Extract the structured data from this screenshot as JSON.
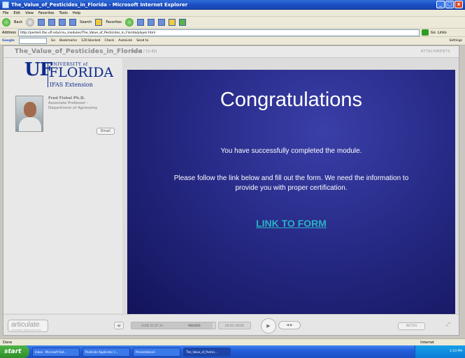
{
  "window": {
    "title": "The_Value_of_Pesticides_in_Florida - Microsoft Internet Explorer",
    "min": "_",
    "max": "□",
    "close": "x"
  },
  "menu": [
    "File",
    "Edit",
    "View",
    "Favorites",
    "Tools",
    "Help"
  ],
  "toolbar": {
    "back": "Back",
    "search": "Search",
    "favorites": "Favorites"
  },
  "address": {
    "label": "Address",
    "url": "http://pested.ifas.ufl.edu/cnu_modules/The_Value_of_Pesticides_in_Florida/player.html",
    "go": "Go",
    "links": "Links"
  },
  "google": {
    "logo": "Google",
    "go_to": "Go",
    "bookmarks": "Bookmarks",
    "blocked": "120 blocked",
    "check": "Check",
    "autolink": "AutoLink",
    "send": "Send to",
    "settings": "Settings"
  },
  "player": {
    "course_title": "The_Value_of_Pesticides_in_Florida",
    "time_info": "(11:40 / 11:42)",
    "attachments": "ATTACHMENTS"
  },
  "logo": {
    "mark": "UF",
    "university": "UNIVERSITY of",
    "florida": "FLORIDA",
    "ifas": "IFAS Extension"
  },
  "presenter": {
    "name": "Fred Fishel Ph.D.",
    "title1": "Associate Professor -",
    "title2": "Department of Agronomy",
    "email": "Email"
  },
  "slide": {
    "title": "Congratulations",
    "message1": "You have successfully completed the module.",
    "message2": "Please follow the link below and fill out the form.  We need the information to provide you with proper certification.",
    "link": "LINK TO FORM"
  },
  "controls": {
    "articulate": "articulate",
    "articulate_sub": "POWERED PRESENTATION",
    "slide_info": "SLIDE 20 OF 20",
    "status": "PAUSED",
    "progress": 0.97,
    "time": "00:03 / 00:05",
    "notes": "NOTES"
  },
  "statusbar": {
    "left": "Done",
    "zone": "Internet"
  },
  "taskbar": {
    "start": "start",
    "tasks": [
      "Inbox - Microsoft Out...",
      "Pesticide Applicator C...",
      "Presentation3",
      "The_Value_of_Pestici..."
    ],
    "clock": "1:10 PM"
  }
}
